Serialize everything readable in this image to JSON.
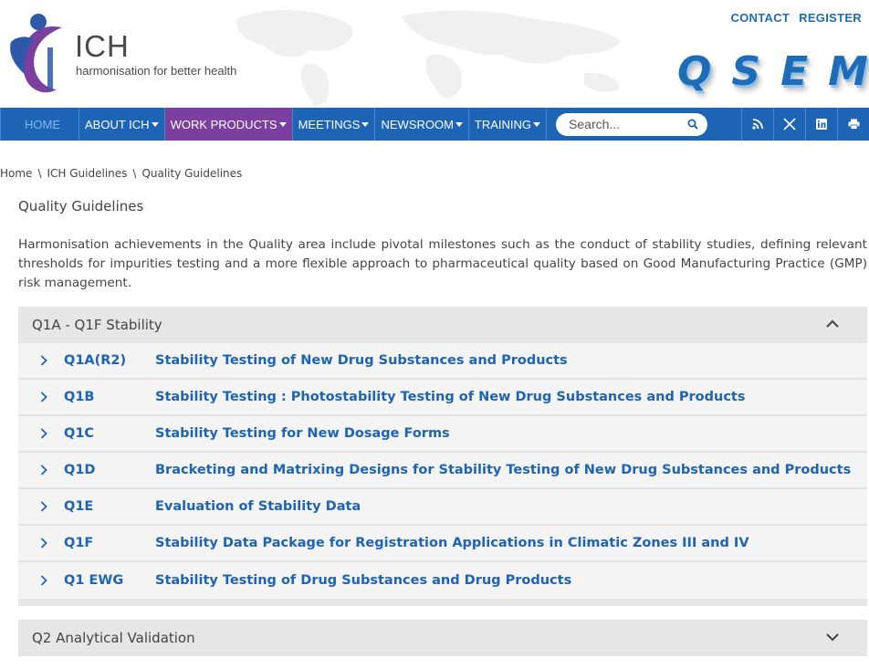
{
  "brand": {
    "logo_text": "ICH",
    "tagline": "harmonisation for better health",
    "qsem_letters": [
      "Q",
      "S",
      "E",
      "M"
    ],
    "accent_blue": "#1e64b4",
    "accent_purple": "#7b3fa0"
  },
  "toplinks": {
    "contact": "CONTACT",
    "register": "REGISTER"
  },
  "nav": {
    "home": "HOME",
    "items": [
      {
        "label": "ABOUT ICH",
        "active": false
      },
      {
        "label": "WORK PRODUCTS",
        "active": true
      },
      {
        "label": "MEETINGS",
        "active": false
      },
      {
        "label": "NEWSROOM",
        "active": false
      },
      {
        "label": "TRAINING",
        "active": false
      }
    ],
    "search_placeholder": "Search...",
    "social_icons": [
      "rss-icon",
      "x-icon",
      "linkedin-icon",
      "print-icon"
    ]
  },
  "breadcrumb": [
    "Home",
    "ICH Guidelines",
    "Quality Guidelines"
  ],
  "page_title": "Quality Guidelines",
  "intro": "Harmonisation achievements in the Quality area include pivotal milestones such as the conduct of stability studies, defining relevant thresholds for impurities testing and a more flexible approach to pharmaceutical quality based on Good Manufacturing Practice (GMP) risk management.",
  "sections": [
    {
      "title": "Q1A - Q1F Stability",
      "expanded": true,
      "items": [
        {
          "code": "Q1A(R2)",
          "title": "Stability Testing of New Drug Substances and Products"
        },
        {
          "code": "Q1B",
          "title": "Stability Testing : Photostability Testing of New Drug Substances and Products"
        },
        {
          "code": "Q1C",
          "title": "Stability Testing for New Dosage Forms"
        },
        {
          "code": "Q1D",
          "title": "Bracketing and Matrixing Designs for Stability Testing of New Drug Substances and Products"
        },
        {
          "code": "Q1E",
          "title": "Evaluation of Stability Data"
        },
        {
          "code": "Q1F",
          "title": "Stability Data Package for Registration Applications in Climatic Zones III and IV"
        },
        {
          "code": "Q1 EWG",
          "title": "Stability Testing of Drug Substances and Drug Products"
        }
      ]
    },
    {
      "title": "Q2 Analytical Validation",
      "expanded": false,
      "items": []
    }
  ]
}
